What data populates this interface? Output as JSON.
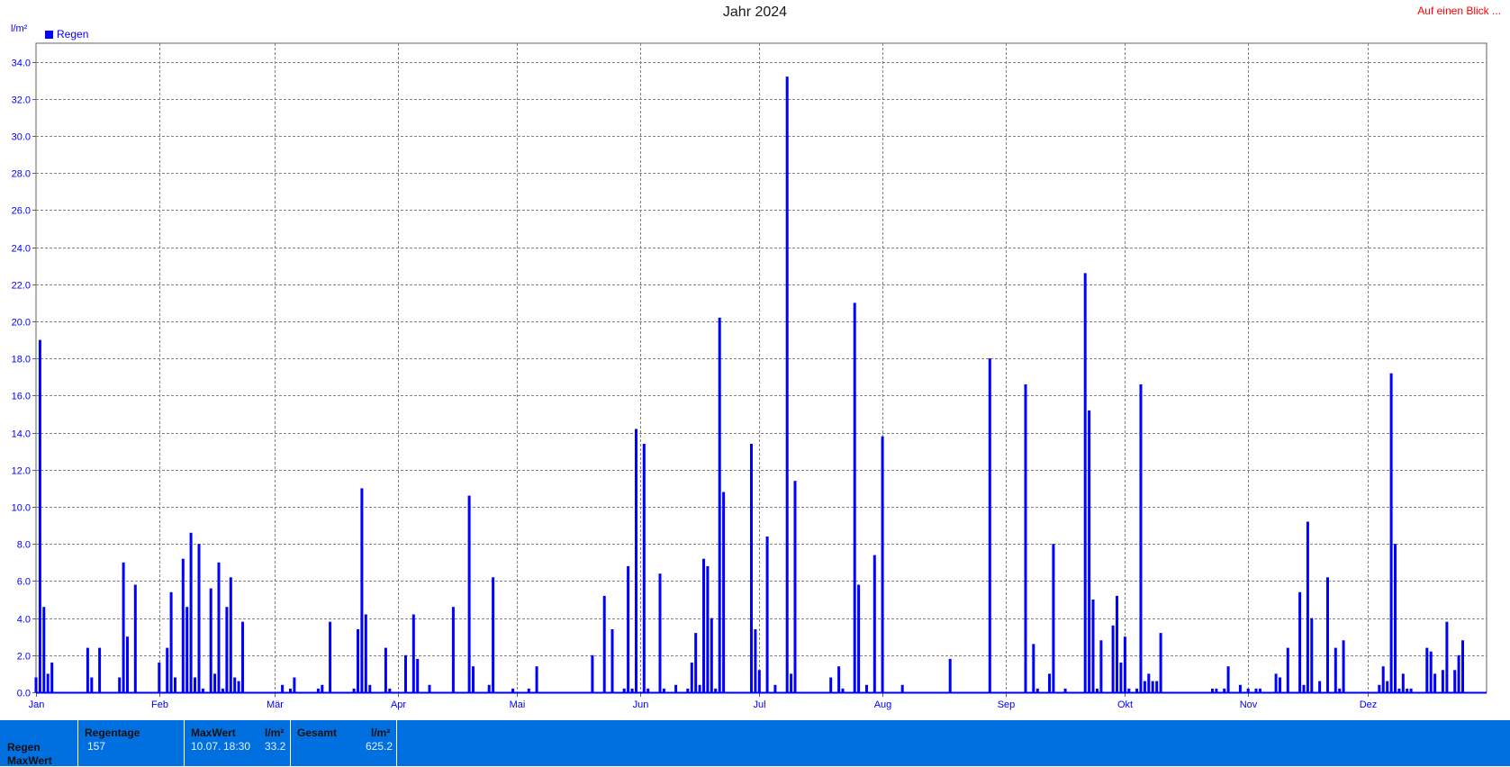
{
  "title": "Jahr 2024",
  "top_link": "Auf einen Blick ...",
  "unit_label": "l/m²",
  "legend": {
    "label": "Regen",
    "color": "#0000ff"
  },
  "stats": {
    "row_label_1": "Regen",
    "row_label_2": "MaxWert",
    "regentage_header": "Regentage",
    "regentage_value": "157",
    "maxwert_header": "MaxWert",
    "maxwert_unit": "l/m²",
    "maxwert_date": "10.07.",
    "maxwert_time": "18:30",
    "maxwert_value": "33.2",
    "gesamt_header": "Gesamt",
    "gesamt_unit": "l/m²",
    "gesamt_value": "625.2"
  },
  "chart_data": {
    "type": "bar",
    "title": "Jahr 2024",
    "ylabel": "l/m²",
    "ylim": [
      0,
      34.0
    ],
    "ytick_values": [
      0,
      2,
      4,
      6,
      8,
      10,
      12,
      14,
      16,
      18,
      20,
      22,
      24,
      26,
      28,
      30,
      32,
      34
    ],
    "ytick_labels": [
      "0.0",
      "2.0",
      "4.0",
      "6.0",
      "8.0",
      "10.0",
      "12.0",
      "14.0",
      "16.0",
      "18.0",
      "20.0",
      "22.0",
      "24.0",
      "26.0",
      "28.0",
      "30.0",
      "32.0",
      "34.0"
    ],
    "xlim": [
      1,
      366
    ],
    "xtick_days": [
      1,
      32,
      61,
      92,
      122,
      153,
      183,
      214,
      245,
      275,
      306,
      336
    ],
    "xtick_labels": [
      "Jan",
      "Feb",
      "Mär",
      "Apr",
      "Mai",
      "Jun",
      "Jul",
      "Aug",
      "Sep",
      "Okt",
      "Nov",
      "Dez"
    ],
    "grid": true,
    "legend_position": "top-left",
    "series": [
      {
        "name": "Regen",
        "color": "#0000ff",
        "points": [
          [
            1,
            0.8
          ],
          [
            2,
            19.0
          ],
          [
            3,
            4.6
          ],
          [
            4,
            1.0
          ],
          [
            5,
            1.6
          ],
          [
            14,
            2.4
          ],
          [
            15,
            0.8
          ],
          [
            17,
            2.4
          ],
          [
            22,
            0.8
          ],
          [
            23,
            7.0
          ],
          [
            24,
            3.0
          ],
          [
            26,
            5.8
          ],
          [
            32,
            1.6
          ],
          [
            34,
            2.4
          ],
          [
            35,
            5.4
          ],
          [
            36,
            0.8
          ],
          [
            38,
            7.2
          ],
          [
            39,
            4.6
          ],
          [
            40,
            8.6
          ],
          [
            41,
            0.8
          ],
          [
            42,
            8.0
          ],
          [
            43,
            0.2
          ],
          [
            45,
            5.6
          ],
          [
            46,
            1.0
          ],
          [
            47,
            7.0
          ],
          [
            48,
            0.2
          ],
          [
            49,
            4.6
          ],
          [
            50,
            6.2
          ],
          [
            51,
            0.8
          ],
          [
            52,
            0.6
          ],
          [
            53,
            3.8
          ],
          [
            63,
            0.4
          ],
          [
            65,
            0.2
          ],
          [
            66,
            0.8
          ],
          [
            72,
            0.2
          ],
          [
            73,
            0.4
          ],
          [
            75,
            3.8
          ],
          [
            81,
            0.2
          ],
          [
            82,
            3.4
          ],
          [
            83,
            11.0
          ],
          [
            84,
            4.2
          ],
          [
            85,
            0.4
          ],
          [
            89,
            2.4
          ],
          [
            90,
            0.2
          ],
          [
            94,
            2.0
          ],
          [
            96,
            4.2
          ],
          [
            97,
            1.8
          ],
          [
            100,
            0.4
          ],
          [
            106,
            4.6
          ],
          [
            110,
            10.6
          ],
          [
            111,
            1.4
          ],
          [
            115,
            0.4
          ],
          [
            116,
            6.2
          ],
          [
            121,
            0.2
          ],
          [
            125,
            0.2
          ],
          [
            127,
            1.4
          ],
          [
            141,
            2.0
          ],
          [
            144,
            5.2
          ],
          [
            146,
            3.4
          ],
          [
            149,
            0.2
          ],
          [
            150,
            6.8
          ],
          [
            151,
            0.2
          ],
          [
            152,
            14.2
          ],
          [
            154,
            13.4
          ],
          [
            155,
            0.2
          ],
          [
            158,
            6.4
          ],
          [
            159,
            0.2
          ],
          [
            162,
            0.4
          ],
          [
            165,
            0.2
          ],
          [
            166,
            1.6
          ],
          [
            167,
            3.2
          ],
          [
            168,
            0.4
          ],
          [
            169,
            7.2
          ],
          [
            170,
            6.8
          ],
          [
            171,
            4.0
          ],
          [
            172,
            0.2
          ],
          [
            173,
            20.2
          ],
          [
            174,
            10.8
          ],
          [
            181,
            13.4
          ],
          [
            182,
            3.4
          ],
          [
            183,
            1.2
          ],
          [
            185,
            8.4
          ],
          [
            187,
            0.4
          ],
          [
            190,
            33.2
          ],
          [
            191,
            1.0
          ],
          [
            192,
            11.4
          ],
          [
            201,
            0.8
          ],
          [
            203,
            1.4
          ],
          [
            204,
            0.2
          ],
          [
            207,
            21.0
          ],
          [
            208,
            5.8
          ],
          [
            210,
            0.4
          ],
          [
            212,
            7.4
          ],
          [
            214,
            13.8
          ],
          [
            219,
            0.4
          ],
          [
            231,
            1.8
          ],
          [
            241,
            18.0
          ],
          [
            250,
            16.6
          ],
          [
            252,
            2.6
          ],
          [
            253,
            0.2
          ],
          [
            256,
            1.0
          ],
          [
            257,
            8.0
          ],
          [
            260,
            0.2
          ],
          [
            265,
            22.6
          ],
          [
            266,
            15.2
          ],
          [
            267,
            5.0
          ],
          [
            268,
            0.2
          ],
          [
            269,
            2.8
          ],
          [
            272,
            3.6
          ],
          [
            273,
            5.2
          ],
          [
            274,
            1.6
          ],
          [
            275,
            3.0
          ],
          [
            276,
            0.2
          ],
          [
            278,
            0.2
          ],
          [
            279,
            16.6
          ],
          [
            280,
            0.6
          ],
          [
            281,
            1.0
          ],
          [
            282,
            0.6
          ],
          [
            283,
            0.6
          ],
          [
            284,
            3.2
          ],
          [
            297,
            0.2
          ],
          [
            298,
            0.2
          ],
          [
            300,
            0.2
          ],
          [
            301,
            1.4
          ],
          [
            304,
            0.4
          ],
          [
            306,
            0.2
          ],
          [
            308,
            0.2
          ],
          [
            309,
            0.2
          ],
          [
            313,
            1.0
          ],
          [
            314,
            0.8
          ],
          [
            316,
            2.4
          ],
          [
            319,
            5.4
          ],
          [
            320,
            0.4
          ],
          [
            321,
            9.2
          ],
          [
            322,
            4.0
          ],
          [
            324,
            0.6
          ],
          [
            326,
            6.2
          ],
          [
            328,
            2.4
          ],
          [
            329,
            0.2
          ],
          [
            330,
            2.8
          ],
          [
            339,
            0.4
          ],
          [
            340,
            1.4
          ],
          [
            341,
            0.6
          ],
          [
            342,
            17.2
          ],
          [
            343,
            8.0
          ],
          [
            344,
            0.2
          ],
          [
            345,
            1.0
          ],
          [
            346,
            0.2
          ],
          [
            347,
            0.2
          ],
          [
            351,
            2.4
          ],
          [
            352,
            2.2
          ],
          [
            353,
            1.0
          ],
          [
            355,
            1.2
          ],
          [
            356,
            3.8
          ],
          [
            358,
            1.2
          ],
          [
            359,
            2.0
          ],
          [
            360,
            2.8
          ]
        ]
      }
    ]
  }
}
